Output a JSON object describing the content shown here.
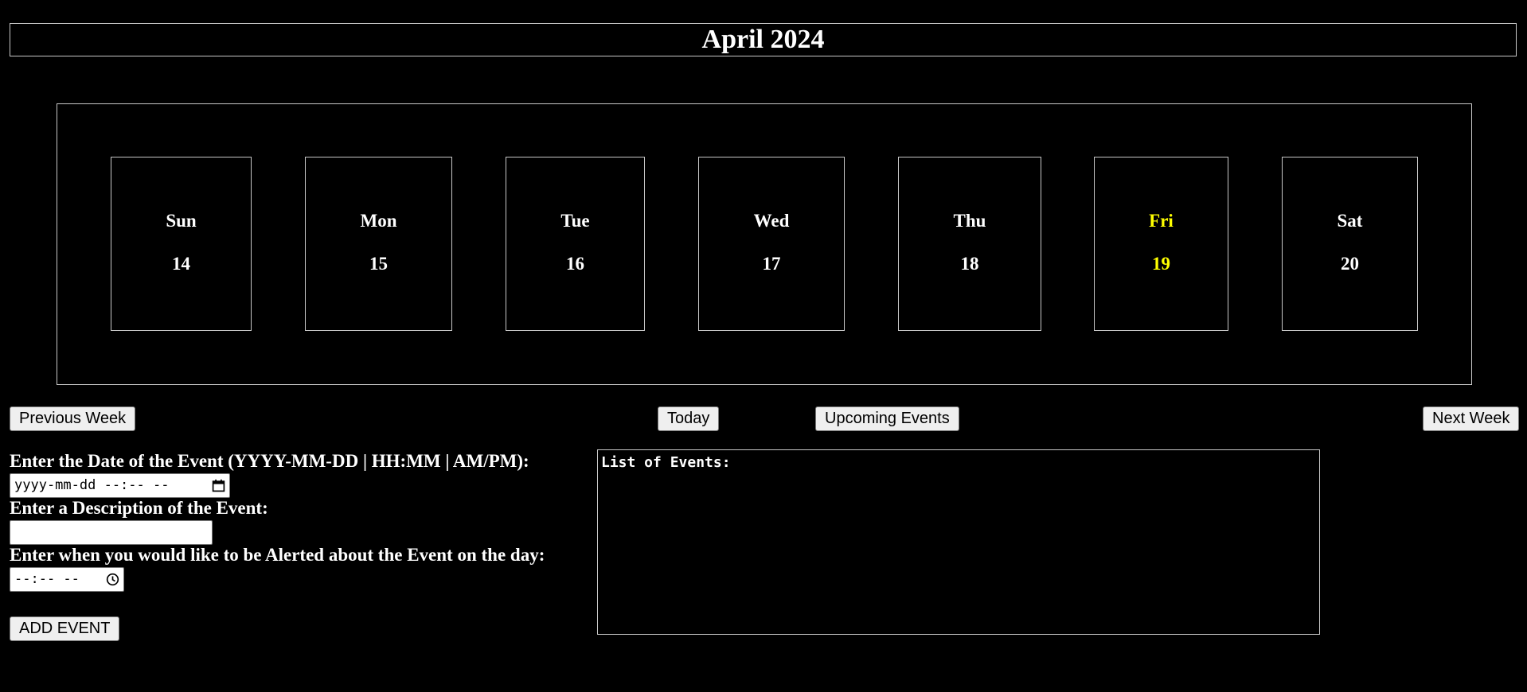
{
  "header": {
    "month_title": "April 2024"
  },
  "week": {
    "days": [
      {
        "name": "Sun",
        "date": "14"
      },
      {
        "name": "Mon",
        "date": "15"
      },
      {
        "name": "Tue",
        "date": "16"
      },
      {
        "name": "Wed",
        "date": "17"
      },
      {
        "name": "Thu",
        "date": "18"
      },
      {
        "name": "Fri",
        "date": "19"
      },
      {
        "name": "Sat",
        "date": "20"
      }
    ],
    "highlight_color": "#ffff00"
  },
  "nav": {
    "previous_label": "Previous Week",
    "today_label": "Today",
    "upcoming_label": "Upcoming Events",
    "next_label": "Next Week"
  },
  "form": {
    "date_label": "Enter the Date of the Event (YYYY-MM-DD | HH:MM | AM/PM):",
    "date_placeholder": "yyyy-mm-dd --:-- --",
    "description_label": "Enter a Description of the Event:",
    "description_value": "",
    "alert_label": "Enter when you would like to be Alerted about the Event on the day:",
    "alert_placeholder": "--:-- --",
    "add_button_label": "ADD EVENT"
  },
  "events": {
    "heading": "List of Events:"
  }
}
